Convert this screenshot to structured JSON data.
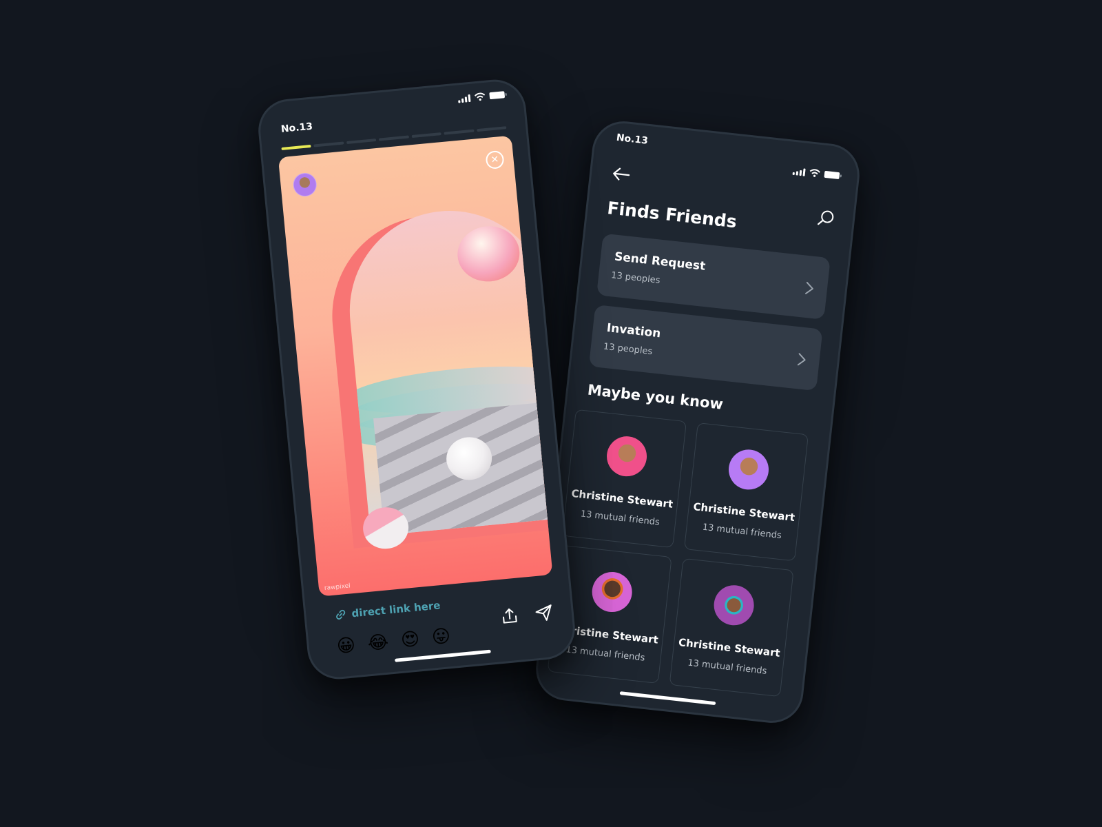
{
  "story_screen": {
    "status": {
      "time": "No.13",
      "icons": [
        "signal-icon",
        "wifi-icon",
        "battery-icon"
      ]
    },
    "progress": {
      "total_segments": 7,
      "active_segment": 1
    },
    "close_icon": "close-circle-icon",
    "watermark": "rawpixel",
    "link": {
      "icon": "link-icon",
      "label": "direct link here"
    },
    "reactions": [
      "😀",
      "😂",
      "😍",
      "😛"
    ],
    "actions": [
      {
        "icon": "share-upload-icon"
      },
      {
        "icon": "send-paper-plane-icon"
      }
    ]
  },
  "friends_screen": {
    "status": {
      "time": "No.13",
      "icons": [
        "signal-icon",
        "wifi-icon",
        "battery-icon"
      ]
    },
    "back_icon": "back-arrow-icon",
    "search_icon": "search-icon",
    "title": "Finds Friends",
    "options": [
      {
        "title": "Send Request",
        "subtitle": "13 peoples"
      },
      {
        "title": "Invation",
        "subtitle": "13 peoples"
      }
    ],
    "section_title": "Maybe you know",
    "friends": [
      {
        "name": "Christine Stewart",
        "mutual": "13 mutual friends",
        "avatar_color": "#f0508a"
      },
      {
        "name": "Christine Stewart",
        "mutual": "13 mutual friends",
        "avatar_color": "#b77bf5"
      },
      {
        "name": "Christine Stewart",
        "mutual": "13 mutual friends",
        "avatar_color": "#d765d6"
      },
      {
        "name": "Christine Stewart",
        "mutual": "13 mutual friends",
        "avatar_color": "#a04bb0"
      }
    ]
  },
  "colors": {
    "background": "#12171f",
    "phone": "#1e2630",
    "card": "#323b47",
    "accent_progress": "#e8ea55",
    "link": "#4ea2b2"
  }
}
